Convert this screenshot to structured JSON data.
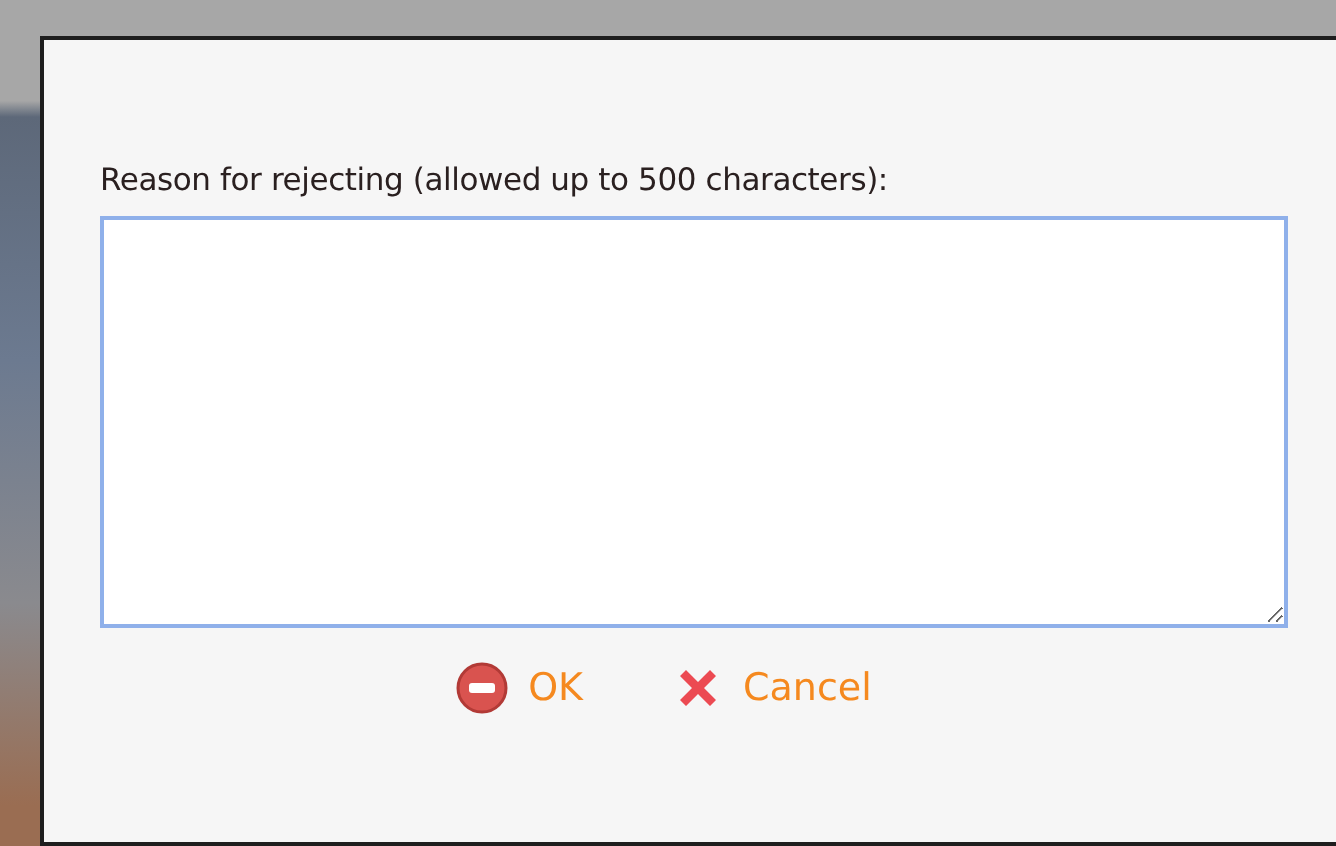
{
  "dialog": {
    "field": {
      "label": "Reason for rejecting (allowed up to 500 characters):",
      "focused": true
    },
    "buttons": [
      {
        "kind": "ok",
        "label": "OK"
      },
      {
        "kind": "cancel",
        "label": "Cancel"
      }
    ]
  }
}
